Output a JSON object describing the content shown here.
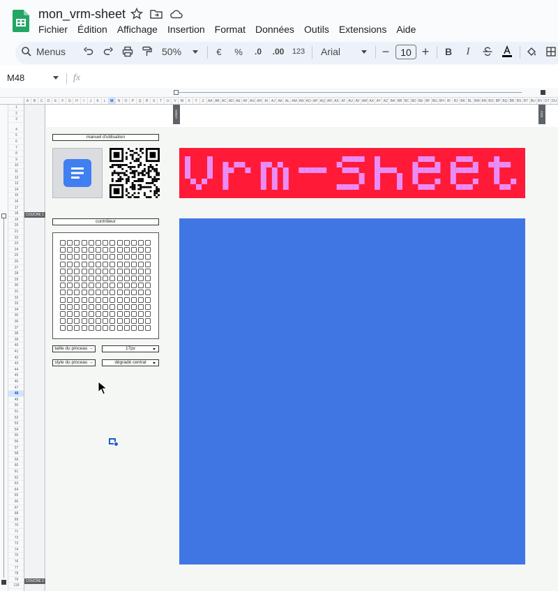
{
  "header": {
    "title": "mon_vrm-sheet",
    "menu": [
      "Fichier",
      "Édition",
      "Affichage",
      "Insertion",
      "Format",
      "Données",
      "Outils",
      "Extensions",
      "Aide"
    ]
  },
  "toolbar": {
    "search_label": "Menus",
    "zoom": "50%",
    "currency": "€",
    "percent": "%",
    "decrease_decimals": ".0",
    "increase_decimals": ".00",
    "number_format": "123",
    "font": "Arial",
    "font_size": "10",
    "minus": "−",
    "plus": "+",
    "bold": "B",
    "italic": "I"
  },
  "formula_bar": {
    "cell_ref": "M48",
    "fx": "fx"
  },
  "grid": {
    "columns": [
      "A",
      "B",
      "C",
      "D",
      "E",
      "F",
      "G",
      "H",
      "I",
      "J",
      "K",
      "L",
      "M",
      "N",
      "O",
      "P",
      "Q",
      "R",
      "S",
      "T",
      "U",
      "V",
      "W",
      "X",
      "Y",
      "Z",
      "AA",
      "AB",
      "AC",
      "AD",
      "AE",
      "AF",
      "AG",
      "AH",
      "AI",
      "AJ",
      "AK",
      "AL",
      "AM",
      "AN",
      "AO",
      "AP",
      "AQ",
      "AR",
      "AS",
      "AT",
      "AU",
      "AV",
      "AW",
      "AX",
      "AY",
      "AZ",
      "BA",
      "BB",
      "BC",
      "BD",
      "BE",
      "BF",
      "BG",
      "BH",
      "BI",
      "BJ",
      "BK",
      "BL",
      "BM",
      "BN",
      "BO",
      "BP",
      "BQ",
      "BR",
      "BS",
      "BT",
      "BU",
      "BV",
      "DT",
      "DU"
    ],
    "selected_column": "M",
    "selected_row": "48",
    "last_row": "118",
    "layer_1": "COUCHE 1",
    "layer_2": "COUCHE 2",
    "tag_sheet": "SHEET",
    "tag_aide": "AIDE"
  },
  "sheet": {
    "manual_label": "manuel d'utilisation",
    "controller_label": "contrôleur",
    "brush_size_label": "taille du pinceau →",
    "brush_size_value": "17px",
    "brush_style_label": "style du pinceau →",
    "brush_style_value": "dégradé central"
  },
  "colors": {
    "accent_blue": "#3f76e4",
    "banner_bg": "#ff1a38",
    "banner_text": "#e98cf5",
    "header_bg": "#f9fbfd",
    "toolbar_pill": "#edf2fa"
  }
}
